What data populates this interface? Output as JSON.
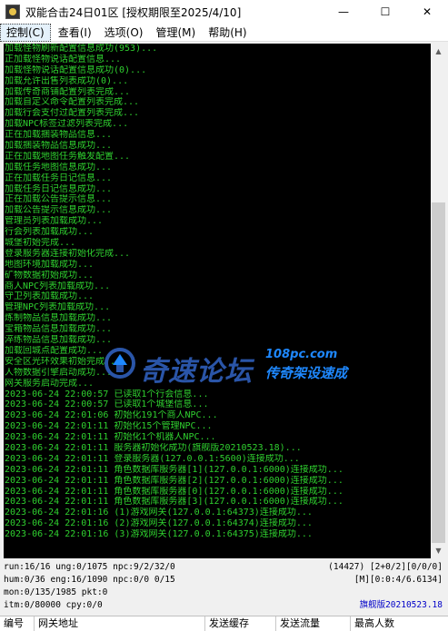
{
  "window": {
    "title": "双能合击24日01区 [授权期限至2025/4/10]",
    "minimize": "—",
    "maximize": "☐",
    "close": "✕"
  },
  "menu": [
    {
      "label": "控制(C)"
    },
    {
      "label": "查看(I)"
    },
    {
      "label": "选项(O)"
    },
    {
      "label": "管理(M)"
    },
    {
      "label": "帮助(H)"
    }
  ],
  "console_lines": [
    "加载怪物刷新配置信息成功(953)...",
    "正加载怪物说话配置信息...",
    "加载怪物说话配置信息成功(0)...",
    "加载允许出售列表成功(0)...",
    "加载传奇商铺配置列表完成...",
    "加载自定义命令配置列表完成...",
    "加载行会支付过配置列表完成...",
    "加载NPC标签过滤列表完成...",
    "正在加载捆装物品信息...",
    "加载捆装物品信息成功...",
    "正在加载地图任务触发配置...",
    "加载任务地图信息成功...",
    "正在加载任务日记信息...",
    "加载任务日记信息成功...",
    "正在加载公告提示信息...",
    "加载公告提示信息成功...",
    "管理员列表加载成功...",
    "行会列表加载成功...",
    "城堡初始完成...",
    "登录服务器连接初始化完成...",
    "地图环境加载成功...",
    "矿物数据初始成功...",
    "商人NPC列表加载成功...",
    "守卫列表加载成功...",
    "管理NPC列表加载成功...",
    "炼制物品信息加载成功...",
    "宝箱物品信息加载成功...",
    "淬练物品信息加载成功...",
    "加载回城点配置成功...",
    "安全区光环效果初始完成...",
    "人物数据引擎启动成功...",
    "网关服务启动完成...",
    "2023-06-24 22:00:57 已读取1个行会信息...",
    "2023-06-24 22:00:57 已读取1个城堡信息...",
    "2023-06-24 22:01:06 初始化191个商人NPC...",
    "2023-06-24 22:01:11 初始化15个管理NPC...",
    "2023-06-24 22:01:11 初始化1个机器人NPC...",
    "2023-06-24 22:01:11 服务器初始化成功(旗舰版20210523.18)...",
    "2023-06-24 22:01:11 登录服务器(127.0.0.1:5600)连接成功...",
    "2023-06-24 22:01:11 角色数据库服务器[1](127.0.0.1:6000)连接成功...",
    "2023-06-24 22:01:11 角色数据库服务器[2](127.0.0.1:6000)连接成功...",
    "2023-06-24 22:01:11 角色数据库服务器[0](127.0.0.1:6000)连接成功...",
    "2023-06-24 22:01:11 角色数据库服务器[3](127.0.0.1:6000)连接成功...",
    "2023-06-24 22:01:16 (1)游戏网关(127.0.0.1:64373)连接成功...",
    "2023-06-24 22:01:16 (2)游戏网关(127.0.0.1:64374)连接成功...",
    "2023-06-24 22:01:16 (3)游戏网关(127.0.0.1:64375)连接成功..."
  ],
  "watermark": {
    "main": "奇速论坛",
    "url": "108pc.com",
    "sub": "传奇架设速成"
  },
  "status": {
    "row1_left": "run:16/16 ung:0/1075 npc:9/2/32/0",
    "row1_right": "(14427) [2+0/2][0/0/0]",
    "row2_left": "hum:0/36 eng:16/1090 npc:0/0 0/15",
    "row2_right": "[M][0:0:4/6.6134]",
    "row3_left": "mon:0/135/1985 pkt:0",
    "row4_left": "itm:0/80000 cpy:0/0",
    "row4_right": "旗舰版20210523.18",
    "version_color": "#0000c8"
  },
  "list_columns": [
    {
      "label": "编号"
    },
    {
      "label": "网关地址"
    },
    {
      "label": "发送缓存"
    },
    {
      "label": "发送流量"
    },
    {
      "label": "最高人数"
    }
  ],
  "colors": {
    "console_bg": "#000000",
    "console_text": "#2fd02f"
  }
}
